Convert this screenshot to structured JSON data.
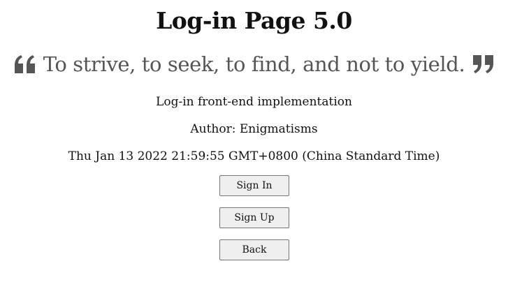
{
  "page": {
    "title": "Log-in Page 5.0",
    "quote": "To strive, to seek, to find, and not to yield.",
    "subtitle": "Log-in front-end implementation",
    "author": "Author: Enigmatisms",
    "datetime": "Thu Jan 13 2022 21:59:55 GMT+0800 (China Standard Time)"
  },
  "icons": {
    "quote_open": "quote-left-icon",
    "quote_close": "quote-right-icon"
  },
  "buttons": {
    "sign_in": "Sign In",
    "sign_up": "Sign Up",
    "back": "Back"
  },
  "colors": {
    "quote_text": "#555555",
    "button_bg": "#efefef",
    "button_border": "#767676"
  }
}
